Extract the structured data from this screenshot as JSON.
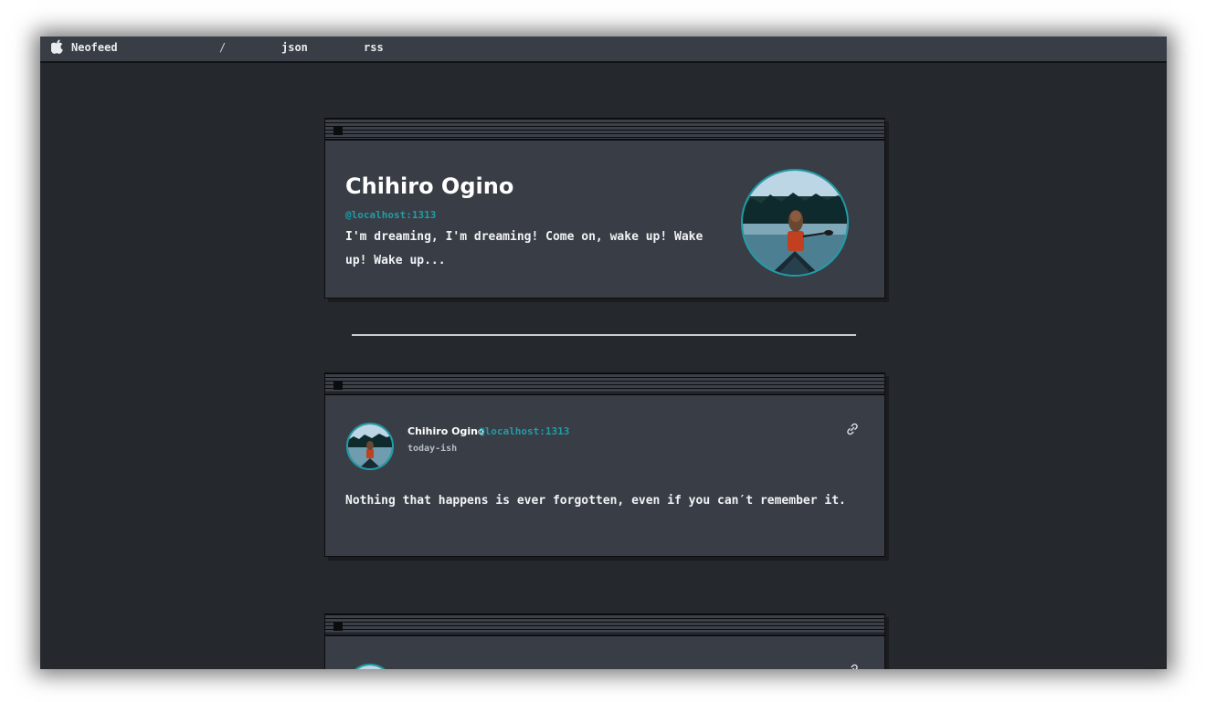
{
  "menubar": {
    "brand": "Neofeed",
    "nav": [
      "/",
      "json",
      "rss"
    ]
  },
  "profile": {
    "name": "Chihiro Ogino",
    "handle": "@localhost:1313",
    "bio": "I'm dreaming, I'm dreaming! Come on, wake up! Wake up! Wake up..."
  },
  "posts": [
    {
      "author": "Chihiro Ogino",
      "handle": "@localhost:1313",
      "time": "today-ish",
      "text": "Nothing that happens is ever forgotten, even if you can′t remember it."
    }
  ],
  "colors": {
    "background": "#25282c",
    "card": "#393e46",
    "accent": "#1f9da8",
    "text": "#f1f3f5"
  },
  "icons": [
    "apple-icon",
    "link-icon",
    "close-box"
  ]
}
